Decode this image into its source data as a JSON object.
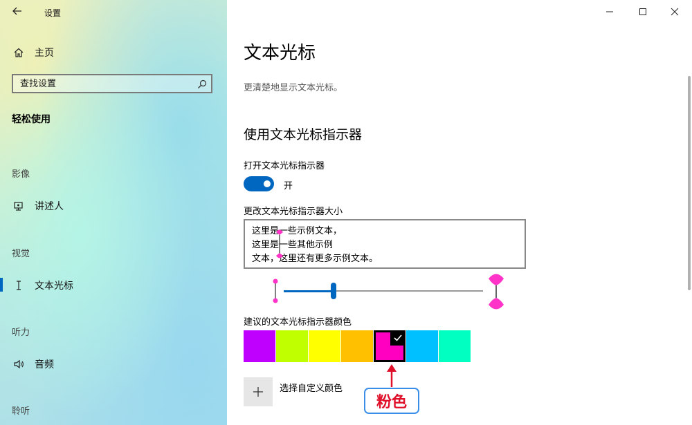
{
  "window": {
    "title": "设置"
  },
  "sidebar": {
    "home": "主页",
    "search_placeholder": "查找设置",
    "section": "轻松使用",
    "groups": [
      {
        "heading": "影像",
        "items": [
          "讲述人"
        ]
      },
      {
        "heading": "视觉",
        "items": [
          "文本光标"
        ]
      },
      {
        "heading": "听力",
        "items": [
          "音频"
        ]
      },
      {
        "heading": "聆听",
        "items": []
      }
    ]
  },
  "main": {
    "title": "文本光标",
    "description": "更清楚地显示文本光标。",
    "subheading": "使用文本光标指示器",
    "toggle_label": "打开文本光标指示器",
    "toggle_state": "开",
    "toggle_on": true,
    "size_label": "更改文本光标指示器大小",
    "preview_lines": [
      "这里是一些示例文本，",
      "这里是一些其他示例",
      "文本，这里还有更多示例文本。"
    ],
    "slider_value": 0.25,
    "colors_label": "建议的文本光标指示器颜色",
    "colors": [
      "#c000ff",
      "#c0ff00",
      "#ffff00",
      "#ffc000",
      "#ff00c0",
      "#00c0ff",
      "#00ffc0"
    ],
    "selected_color_index": 4,
    "custom_color_label": "选择自定义颜色",
    "annotation": "粉色"
  }
}
